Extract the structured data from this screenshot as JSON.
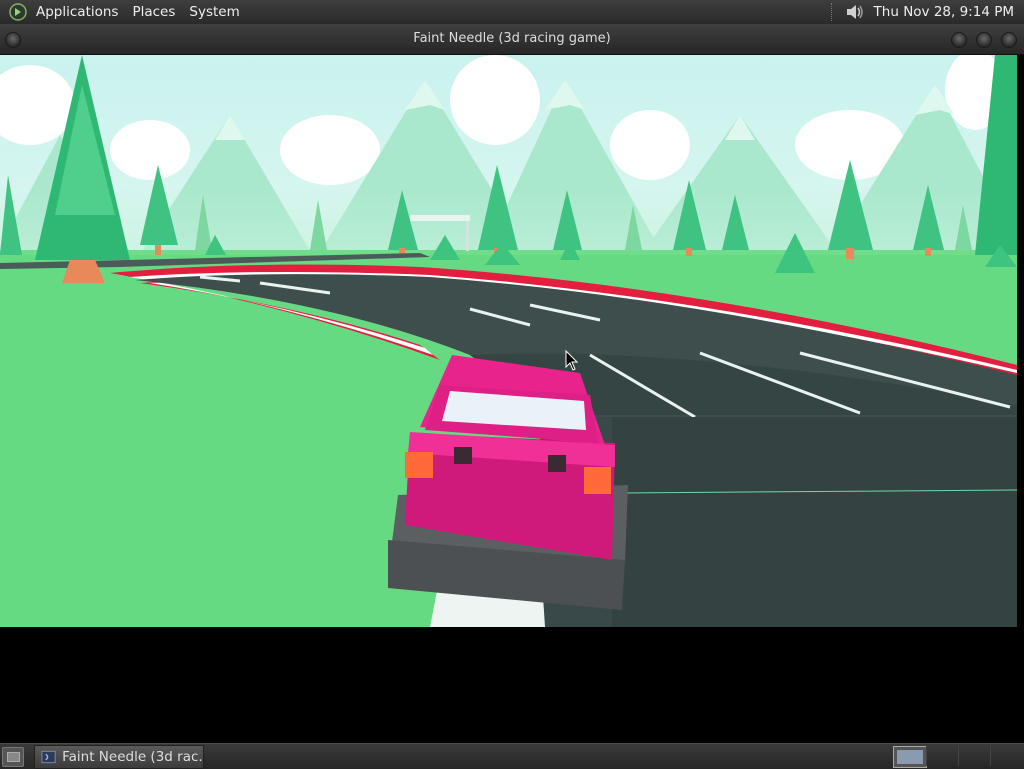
{
  "top_panel": {
    "menus": [
      {
        "label": "Applications"
      },
      {
        "label": "Places"
      },
      {
        "label": "System"
      }
    ],
    "clock": "Thu Nov 28,  9:14 PM",
    "icons": {
      "logo": "app-menu-logo-icon",
      "volume": "volume-icon"
    }
  },
  "window": {
    "title": "Faint Needle (3d racing game)"
  },
  "game": {
    "description_scene": "low-poly racing game",
    "colors": {
      "sky": "#cdf3ee",
      "grass": "#63da80",
      "road": "#3c4d4b",
      "car_body": "#e51e8a",
      "curb_red": "#e21f3f",
      "tree": "#2ab56f"
    }
  },
  "taskbar": {
    "task_label": "Faint Needle (3d rac...",
    "icons": {
      "show_desktop": "show-desktop-icon",
      "task": "window-icon"
    }
  }
}
